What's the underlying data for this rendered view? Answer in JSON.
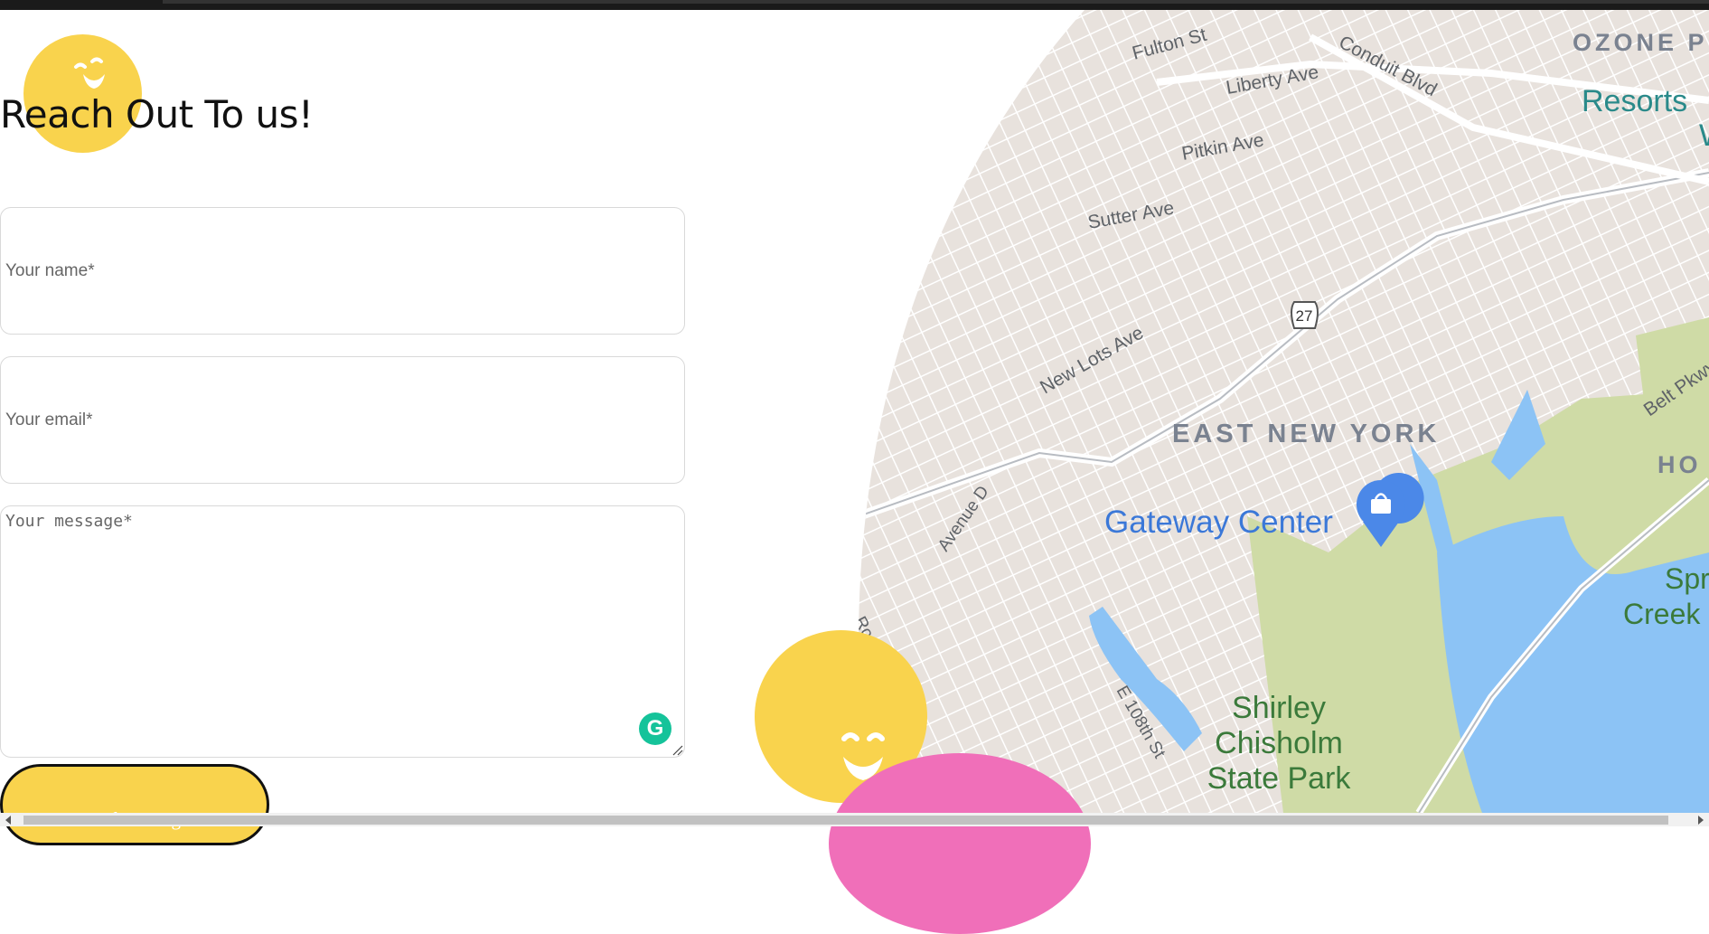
{
  "contact": {
    "title": "Reach Out To us!",
    "name_placeholder": "Your name*",
    "email_placeholder": "Your email*",
    "message_placeholder": "Your message*",
    "send_label": "Send Message"
  },
  "colors": {
    "accent_yellow": "#f9d34d",
    "accent_pink": "#f06fb9",
    "grammarly": "#15c39a"
  },
  "icons": {
    "grammarly": "G"
  },
  "map": {
    "route_shield": "27",
    "labels": {
      "fulton": "Fulton St",
      "liberty": "Liberty Ave",
      "conduit": "Conduit Blvd",
      "ozone": "OZONE P",
      "resorts": "Resorts",
      "resorts_w": "W",
      "pitkin": "Pitkin Ave",
      "sutter": "Sutter Ave",
      "new_lots": "New Lots Ave",
      "east_ny": "EAST NEW YORK",
      "gateway": "Gateway Center",
      "avenue_d": "Avenue D",
      "rockaway": "Rockaway Pkwy",
      "e108": "E 108th St",
      "shirley1": "Shirley",
      "shirley2": "Chisholm",
      "shirley3": "State Park",
      "belt": "Belt Pkwy",
      "ho": "HO",
      "spring1": "Spr",
      "spring2": "Creek"
    }
  }
}
